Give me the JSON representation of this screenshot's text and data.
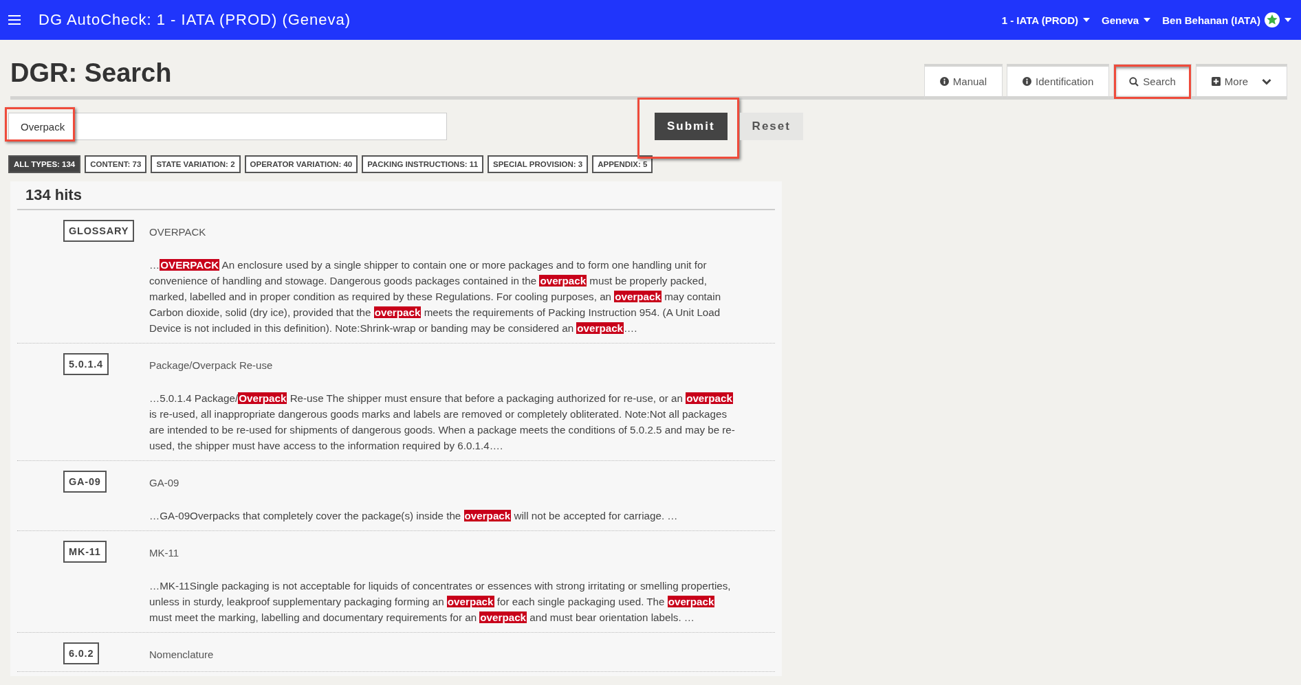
{
  "header": {
    "title": "DG AutoCheck: 1 - IATA (PROD) (Geneva)",
    "menus": [
      "1 - IATA (PROD)",
      "Geneva",
      "Ben Behanan (IATA)"
    ]
  },
  "page_title": "DGR: Search",
  "tabs": [
    {
      "label": "Manual",
      "kind": "info",
      "marked": false
    },
    {
      "label": "Identification",
      "kind": "info",
      "marked": false
    },
    {
      "label": "Search",
      "kind": "search",
      "marked": true
    },
    {
      "label": "More",
      "kind": "menu",
      "marked": false
    }
  ],
  "search": {
    "value": "Overpack",
    "marked": true
  },
  "buttons": [
    {
      "label": "Submit",
      "kind": "primary",
      "marked": true
    },
    {
      "label": "Reset",
      "kind": "secondary",
      "marked": false
    }
  ],
  "filters": [
    {
      "label": "ALL TYPES: 134",
      "selected": true
    },
    {
      "label": "CONTENT: 73",
      "selected": false
    },
    {
      "label": "STATE VARIATION: 2",
      "selected": false
    },
    {
      "label": "OPERATOR VARIATION: 40",
      "selected": false
    },
    {
      "label": "PACKING INSTRUCTIONS: 11",
      "selected": false
    },
    {
      "label": "SPECIAL PROVISION: 3",
      "selected": false
    },
    {
      "label": "APPENDIX: 5",
      "selected": false
    }
  ],
  "results": {
    "count": "134 hits",
    "items": [
      {
        "tag": "GLOSSARY",
        "title": "OVERPACK",
        "snippet": "…**OVERPACK** An enclosure used by a single shipper to contain one or more packages and to form one handling unit for convenience of handling and stowage. Dangerous goods packages contained in the **overpack** must be properly packed, marked, labelled and in proper condition as required by these Regulations. For cooling purposes, an **overpack** may contain Carbon dioxide, solid (dry ice), provided that the **overpack** meets the requirements of Packing Instruction 954. (A Unit Load Device is not included in this definition). Note:Shrink-wrap or banding may be considered an **overpack**…."
      },
      {
        "tag": "5.0.1.4",
        "title": "Package/Overpack Re-use",
        "snippet": "…5.0.1.4 Package/**Overpack** Re-use The shipper must ensure that before a packaging authorized for re-use, or an **overpack** is re-used, all inappropriate dangerous goods marks and labels are removed or completely obliterated. Note:Not all packages are intended to be re-used for shipments of dangerous goods. When a package meets the conditions of 5.0.2.5 and may be re-used, the shipper must have access to the information required by 6.0.1.4…."
      },
      {
        "tag": "GA-09",
        "title": "GA-09",
        "snippet": "…GA-09Overpacks that completely cover the package(s) inside the **overpack** will not be accepted for carriage. …"
      },
      {
        "tag": "MK-11",
        "title": "MK-11",
        "snippet": "…MK-11Single packaging is not acceptable for liquids of concentrates or essences with strong irritating or smelling properties, unless in sturdy, leakproof supplementary packaging forming an **overpack** for each single packaging used. The **overpack** must meet the marking, labelling and documentary requirements for an **overpack** and must bear orientation labels. …"
      },
      {
        "tag": "6.0.2",
        "title": "Nomenclature"
      }
    ]
  }
}
